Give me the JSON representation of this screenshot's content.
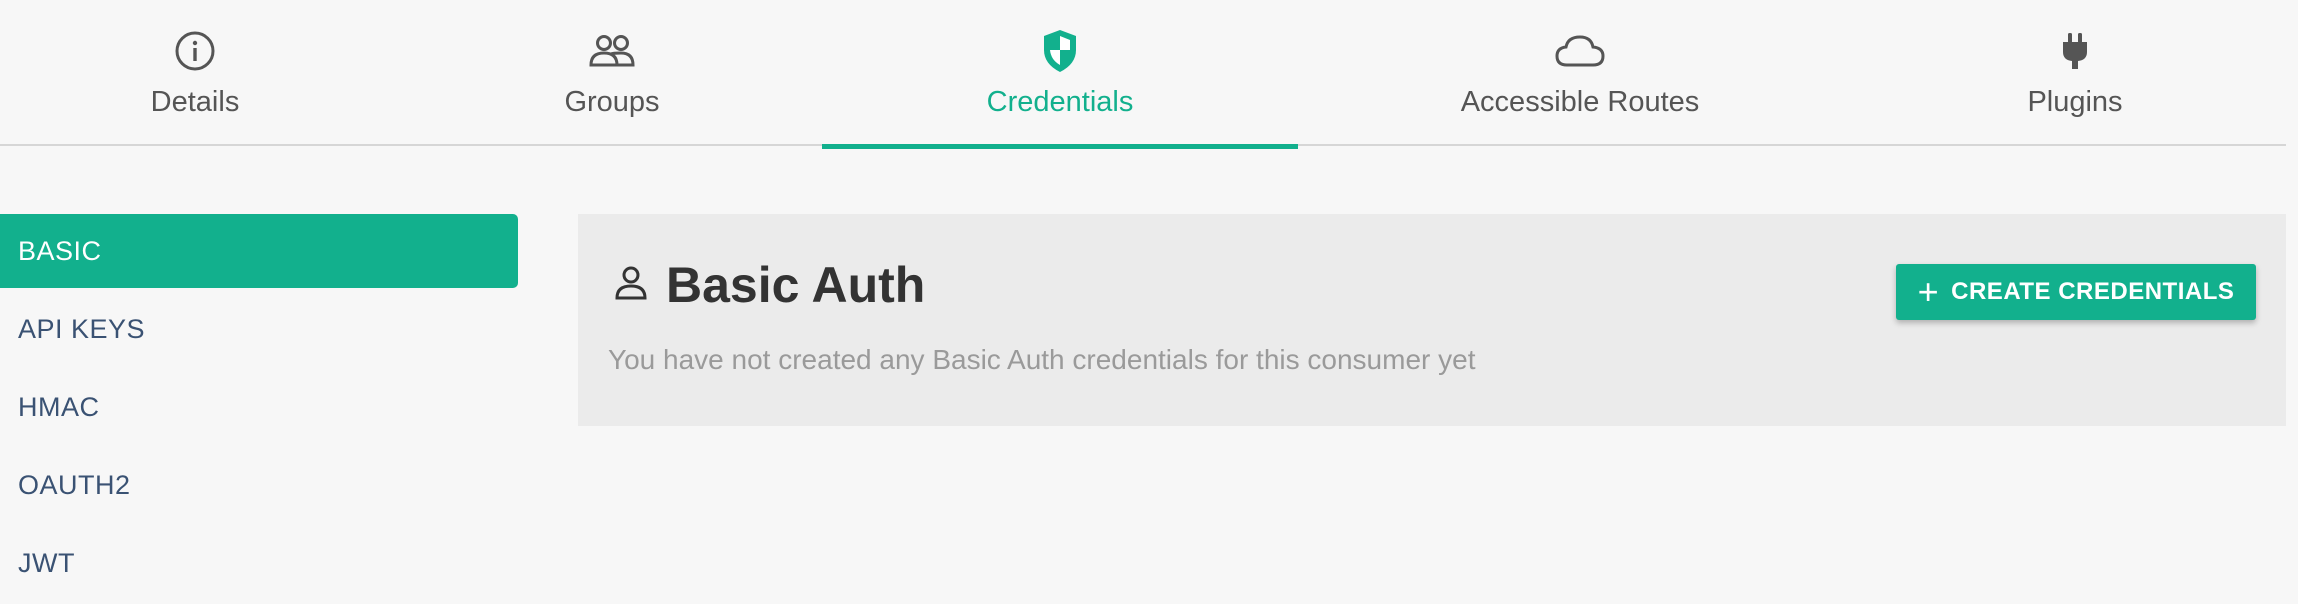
{
  "tabs": [
    {
      "label": "Details",
      "icon": "info-icon",
      "active": false
    },
    {
      "label": "Groups",
      "icon": "groups-icon",
      "active": false
    },
    {
      "label": "Credentials",
      "icon": "shield-icon",
      "active": true
    },
    {
      "label": "Accessible Routes",
      "icon": "cloud-icon",
      "active": false
    },
    {
      "label": "Plugins",
      "icon": "plug-icon",
      "active": false
    }
  ],
  "sidebar": {
    "items": [
      {
        "label": "BASIC",
        "active": true
      },
      {
        "label": "API KEYS",
        "active": false
      },
      {
        "label": "HMAC",
        "active": false
      },
      {
        "label": "OAUTH2",
        "active": false
      },
      {
        "label": "JWT",
        "active": false
      }
    ]
  },
  "panel": {
    "icon": "user-icon",
    "title": "Basic Auth",
    "description": "You have not created any Basic Auth credentials for this consumer yet",
    "create_button_label": "CREATE CREDENTIALS"
  },
  "colors": {
    "accent": "#12b08d",
    "sidebar_text": "#3a5273",
    "muted_text": "#9a9a9a"
  }
}
